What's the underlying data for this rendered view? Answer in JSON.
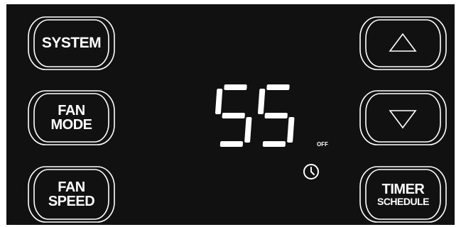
{
  "buttons": {
    "system": {
      "line1": "SYSTEM"
    },
    "fan_mode": {
      "line1": "FAN",
      "line2": "MODE"
    },
    "fan_speed": {
      "line1": "FAN",
      "line2": "SPEED"
    },
    "up": {
      "icon": "triangle-up-icon"
    },
    "down": {
      "icon": "triangle-down-icon"
    },
    "timer": {
      "line1": "TIMER",
      "line2": "SCHEDULE"
    }
  },
  "display": {
    "temperature": "55",
    "status": "OFF",
    "clock_icon": "clock-icon"
  },
  "colors": {
    "panel": "#111111",
    "foreground": "#ffffff"
  }
}
